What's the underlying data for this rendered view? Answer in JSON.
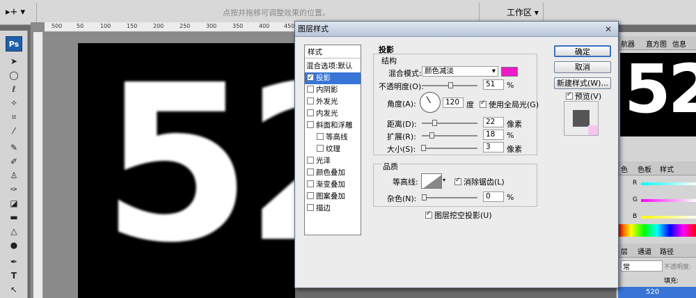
{
  "topbar": {
    "hint": "点按并拖移可调整效果的位置。",
    "workspace": "工作区 ▾",
    "tool_glyph": "▸+ ▾"
  },
  "tools": {
    "logo": "Ps"
  },
  "ruler": {
    "ticks": [
      "500",
      "50",
      "100",
      "150",
      "200",
      "250",
      "300",
      "350",
      "400",
      "450"
    ]
  },
  "canvas": {
    "text": "52"
  },
  "right_panel": {
    "tabs_top": [
      "航器",
      "直方图",
      "信息"
    ],
    "nav_text": "52",
    "tabs_color": [
      "色",
      "色板",
      "样式"
    ],
    "rgb_labels": [
      "R",
      "G",
      "B"
    ],
    "tabs_layers": [
      "层",
      "通道",
      "路径"
    ],
    "blend": "常",
    "opacity_label": "不透明度:",
    "fill_label": "填充:",
    "layer_name": "520"
  },
  "dialog": {
    "title": "图层样式",
    "close": "✕",
    "styles_header": "样式",
    "styles": [
      {
        "label": "混合选项:默认",
        "check": false,
        "sub": false,
        "selected": false,
        "nocb": true
      },
      {
        "label": "投影",
        "check": true,
        "sub": false,
        "selected": true
      },
      {
        "label": "内阴影",
        "check": false,
        "sub": false,
        "selected": false
      },
      {
        "label": "外发光",
        "check": false,
        "sub": false,
        "selected": false
      },
      {
        "label": "内发光",
        "check": false,
        "sub": false,
        "selected": false
      },
      {
        "label": "斜面和浮雕",
        "check": false,
        "sub": false,
        "selected": false
      },
      {
        "label": "等高线",
        "check": false,
        "sub": true,
        "selected": false
      },
      {
        "label": "纹理",
        "check": false,
        "sub": true,
        "selected": false
      },
      {
        "label": "光泽",
        "check": false,
        "sub": false,
        "selected": false
      },
      {
        "label": "颜色叠加",
        "check": false,
        "sub": false,
        "selected": false
      },
      {
        "label": "渐变叠加",
        "check": false,
        "sub": false,
        "selected": false
      },
      {
        "label": "图案叠加",
        "check": false,
        "sub": false,
        "selected": false
      },
      {
        "label": "描边",
        "check": false,
        "sub": false,
        "selected": false
      }
    ],
    "section_title": "投影",
    "structure": "结构",
    "blend_mode_label": "混合模式:",
    "blend_mode_value": "颜色减淡",
    "shadow_color": "#ec1ac7",
    "opacity_label": "不透明度(O):",
    "opacity_value": "51",
    "opacity_unit": "%",
    "opacity_level": 51,
    "angle_label": "角度(A):",
    "angle_value": "120",
    "angle_unit": "度",
    "global_light_label": "使用全局光(G)",
    "distance_label": "距离(D):",
    "distance_value": "22",
    "distance_unit": "像素",
    "distance_level": 22,
    "spread_label": "扩展(R):",
    "spread_value": "18",
    "spread_unit": "%",
    "spread_level": 18,
    "size_label": "大小(S):",
    "size_value": "3",
    "size_unit": "像素",
    "size_level": 3,
    "quality": "品质",
    "contour_label": "等高线:",
    "antialias_label": "消除锯齿(L)",
    "noise_label": "杂色(N):",
    "noise_value": "0",
    "noise_unit": "%",
    "knockout_label": "图层挖空投影(U)",
    "buttons": {
      "ok": "确定",
      "cancel": "取消",
      "new_style": "新建样式(W)...",
      "preview": "预览(V)"
    }
  }
}
